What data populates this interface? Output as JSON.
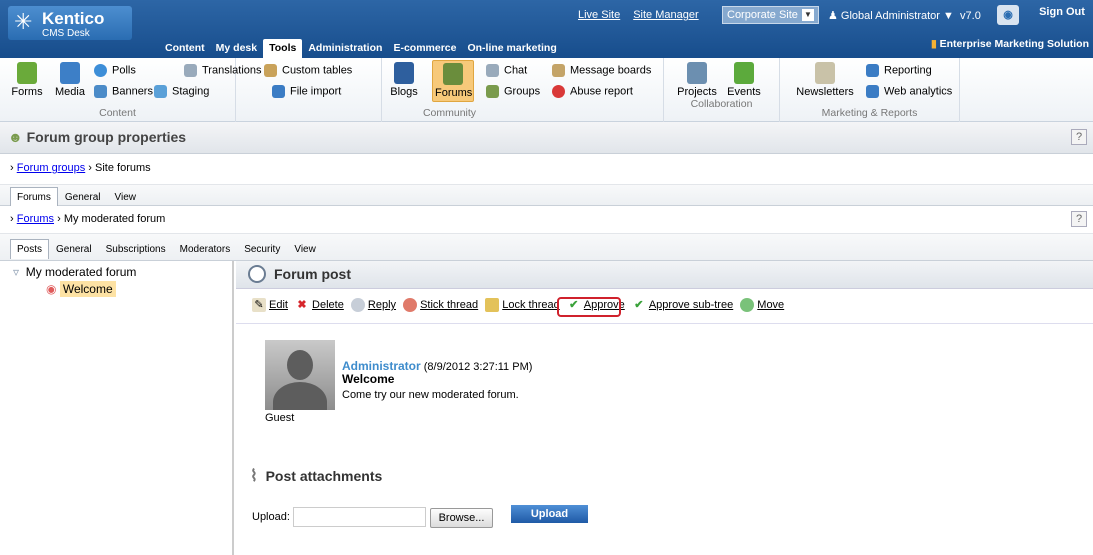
{
  "brand": {
    "name": "Kentico",
    "sub": "CMS Desk"
  },
  "top": {
    "live_site": "Live Site",
    "site_manager": "Site Manager",
    "site_select": "Corporate Site",
    "user": "Global Administrator ▼",
    "version": "v7.0",
    "sign_out": "Sign Out",
    "ems": "Enterprise Marketing Solution"
  },
  "menu": [
    "Content",
    "My desk",
    "Tools",
    "Administration",
    "E-commerce",
    "On-line marketing"
  ],
  "ribbon": {
    "content": {
      "name": "Content",
      "forms": "Forms",
      "media": "Media",
      "polls": "Polls",
      "banners": "Banners",
      "staging": "Staging",
      "translations": "Translations",
      "custom_tables": "Custom tables",
      "file_import": "File import"
    },
    "community": {
      "name": "Community",
      "blogs": "Blogs",
      "forums": "Forums",
      "chat": "Chat",
      "groups": "Groups",
      "message_boards": "Message boards",
      "abuse_report": "Abuse report"
    },
    "collaboration": {
      "name": "Collaboration",
      "projects": "Projects",
      "events": "Events"
    },
    "marketing": {
      "name": "Marketing & Reports",
      "newsletters": "Newsletters",
      "reporting": "Reporting",
      "web_analytics": "Web analytics"
    }
  },
  "page_title": "Forum group properties",
  "crumb1": {
    "link": "Forum groups",
    "current": "Site forums"
  },
  "tabs1": [
    "Forums",
    "General",
    "View"
  ],
  "crumb2": {
    "link": "Forums",
    "current": "My moderated forum"
  },
  "tabs2": [
    "Posts",
    "General",
    "Subscriptions",
    "Moderators",
    "Security",
    "View"
  ],
  "tree": {
    "root": "My moderated forum",
    "leaf": "Welcome"
  },
  "post": {
    "header": "Forum post",
    "actions": {
      "edit": "Edit",
      "delete": "Delete",
      "reply": "Reply",
      "stick": "Stick thread",
      "lock": "Lock thread",
      "approve": "Approve",
      "approve_subtree": "Approve sub-tree",
      "move": "Move"
    },
    "author": "Administrator",
    "date": "(8/9/2012 3:27:11 PM)",
    "title": "Welcome",
    "text": "Come try our new moderated forum.",
    "role": "Guest"
  },
  "attachments": {
    "header": "Post attachments",
    "upload_label": "Upload:",
    "browse": "Browse...",
    "upload": "Upload"
  },
  "colors": {
    "header": "#1e5696",
    "accent": "#3e8ccc",
    "highlight": "#d0212c"
  }
}
